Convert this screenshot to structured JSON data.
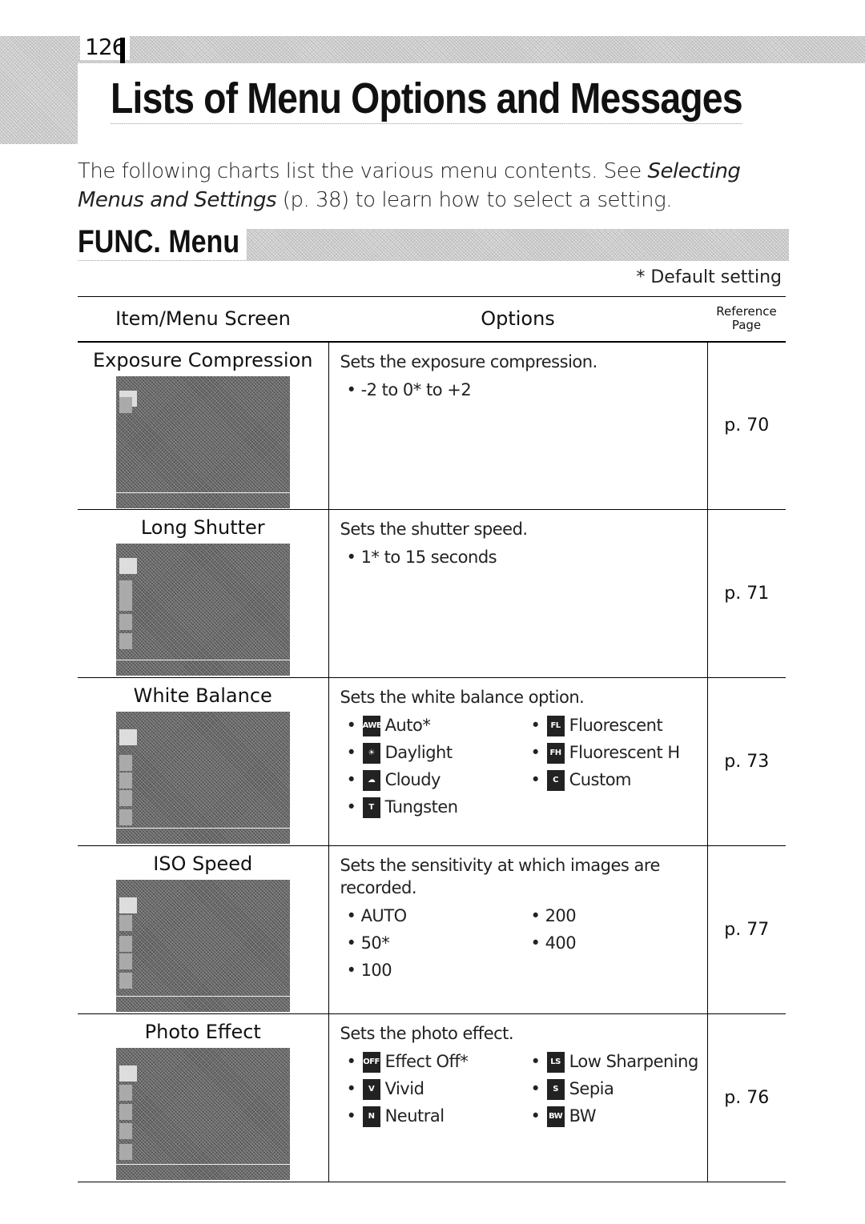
{
  "page_number": "126",
  "title": "Lists of Menu Options and Messages",
  "intro": {
    "text1": "The following charts list the various menu contents. See ",
    "italic1": "Selecting Menus and Settings",
    "text2": " (p. 38) to learn how to select a setting."
  },
  "section_title": "FUNC. Menu",
  "default_note": "* Default setting",
  "table": {
    "headers": {
      "item": "Item/Menu Screen",
      "options": "Options",
      "ref1": "Reference",
      "ref2": "Page"
    },
    "rows": [
      {
        "item": "Exposure Compression",
        "desc": "Sets the exposure compression.",
        "options": [
          {
            "text": "-2 to 0* to +2"
          }
        ],
        "page": "p. 70"
      },
      {
        "item": "Long Shutter",
        "desc": "Sets the shutter speed.",
        "options": [
          {
            "text": "1* to 15 seconds"
          }
        ],
        "page": "p. 71"
      },
      {
        "item": "White Balance",
        "desc": "Sets the white balance option.",
        "options": [
          {
            "icon": "AWB",
            "text": "Auto*"
          },
          {
            "icon": "FL",
            "text": "Fluorescent"
          },
          {
            "icon": "☀",
            "text": "Daylight"
          },
          {
            "icon": "FH",
            "text": "Fluorescent H"
          },
          {
            "icon": "☁",
            "text": "Cloudy"
          },
          {
            "icon": "C",
            "text": "Custom"
          },
          {
            "icon": "T",
            "text": "Tungsten"
          }
        ],
        "page": "p. 73"
      },
      {
        "item": "ISO Speed",
        "desc": "Sets the sensitivity at which images are recorded.",
        "options": [
          {
            "text": "AUTO"
          },
          {
            "text": "200"
          },
          {
            "text": "50*"
          },
          {
            "text": "400"
          },
          {
            "text": "100"
          }
        ],
        "page": "p. 77"
      },
      {
        "item": "Photo Effect",
        "desc": "Sets the photo effect.",
        "options": [
          {
            "icon": "OFF",
            "text": "Effect Off*"
          },
          {
            "icon": "LS",
            "text": "Low Sharpening"
          },
          {
            "icon": "V",
            "text": "Vivid"
          },
          {
            "icon": "S",
            "text": "Sepia"
          },
          {
            "icon": "N",
            "text": "Neutral"
          },
          {
            "icon": "BW",
            "text": "BW"
          }
        ],
        "page": "p. 76"
      }
    ]
  }
}
